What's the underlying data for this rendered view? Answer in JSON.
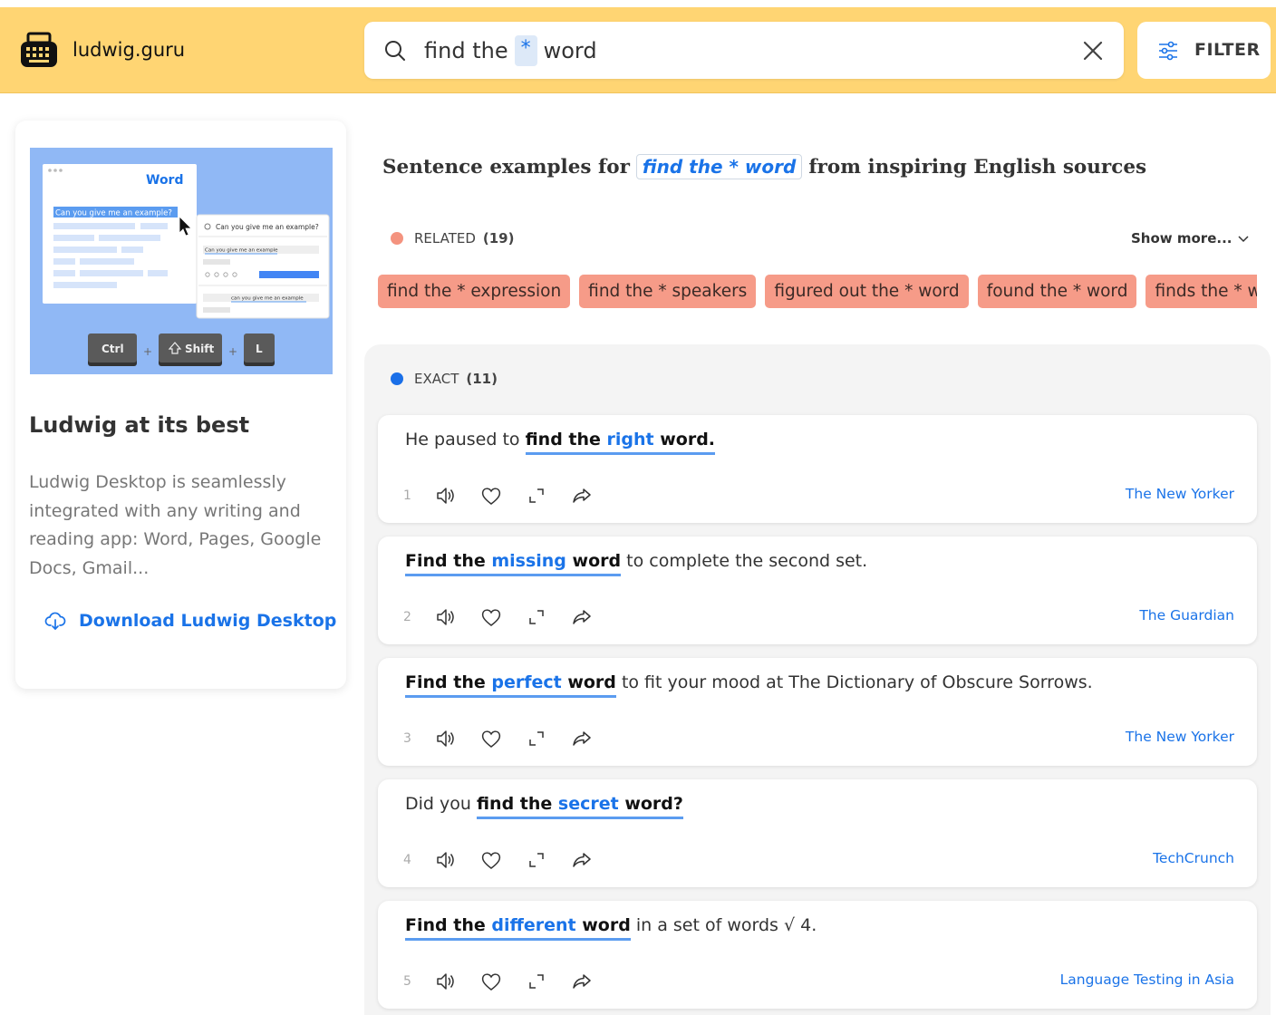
{
  "header": {
    "site_name": "ludwig.guru",
    "search": {
      "before": "find the",
      "wildcard": "*",
      "after": "word"
    },
    "filter_label": "FILTER"
  },
  "promo": {
    "image": {
      "app_title": "Word",
      "selected_text": "Can you give me an example?",
      "popup_query": "Can you give me an example?",
      "popup_suggestion": "Can you give me an example",
      "popup_footer": "can you give me an example",
      "keys": [
        "Ctrl",
        "Shift",
        "L"
      ]
    },
    "title": "Ludwig at its best",
    "description": "Ludwig Desktop is seamlessly integrated with any writing and reading app: Word, Pages, Google Docs, Gmail...",
    "download_label": "Download Ludwig Desktop"
  },
  "heading": {
    "prefix": "Sentence examples for",
    "query": "find the * word",
    "suffix": "from inspiring English sources"
  },
  "related": {
    "label": "RELATED",
    "count": "(19)",
    "show_more": "Show more...",
    "color": "#f4937f",
    "chips": [
      "find the * expression",
      "find the * speakers",
      "figured out the * word",
      "found the * word",
      "finds the * word"
    ]
  },
  "exact": {
    "label": "EXACT",
    "count": "(11)",
    "color": "#1a6fe8",
    "results": [
      {
        "num": "1",
        "pre": "He paused to ",
        "m1": "find the ",
        "var": "right",
        "m2": " word.",
        "post": "",
        "source": "The New Yorker"
      },
      {
        "num": "2",
        "pre": "",
        "m1": "Find the ",
        "var": "missing",
        "m2": " word",
        "post": " to complete the second set.",
        "source": "The Guardian"
      },
      {
        "num": "3",
        "pre": "",
        "m1": "Find the ",
        "var": "perfect",
        "m2": " word",
        "post": " to fit your mood at The Dictionary of Obscure Sorrows.",
        "source": "The New Yorker"
      },
      {
        "num": "4",
        "pre": "Did you ",
        "m1": "find the ",
        "var": "secret",
        "m2": " word?",
        "post": "",
        "source": "TechCrunch"
      },
      {
        "num": "5",
        "pre": "",
        "m1": "Find the ",
        "var": "different",
        "m2": " word",
        "post": " in a set of words √   4.",
        "source": "Language Testing in Asia"
      }
    ]
  },
  "icons": {
    "search": "search-icon",
    "clear": "close-icon",
    "filter": "sliders-icon",
    "download": "cloud-download-icon",
    "speak": "speaker-icon",
    "like": "heart-icon",
    "expand": "expand-icon",
    "share": "share-icon"
  }
}
